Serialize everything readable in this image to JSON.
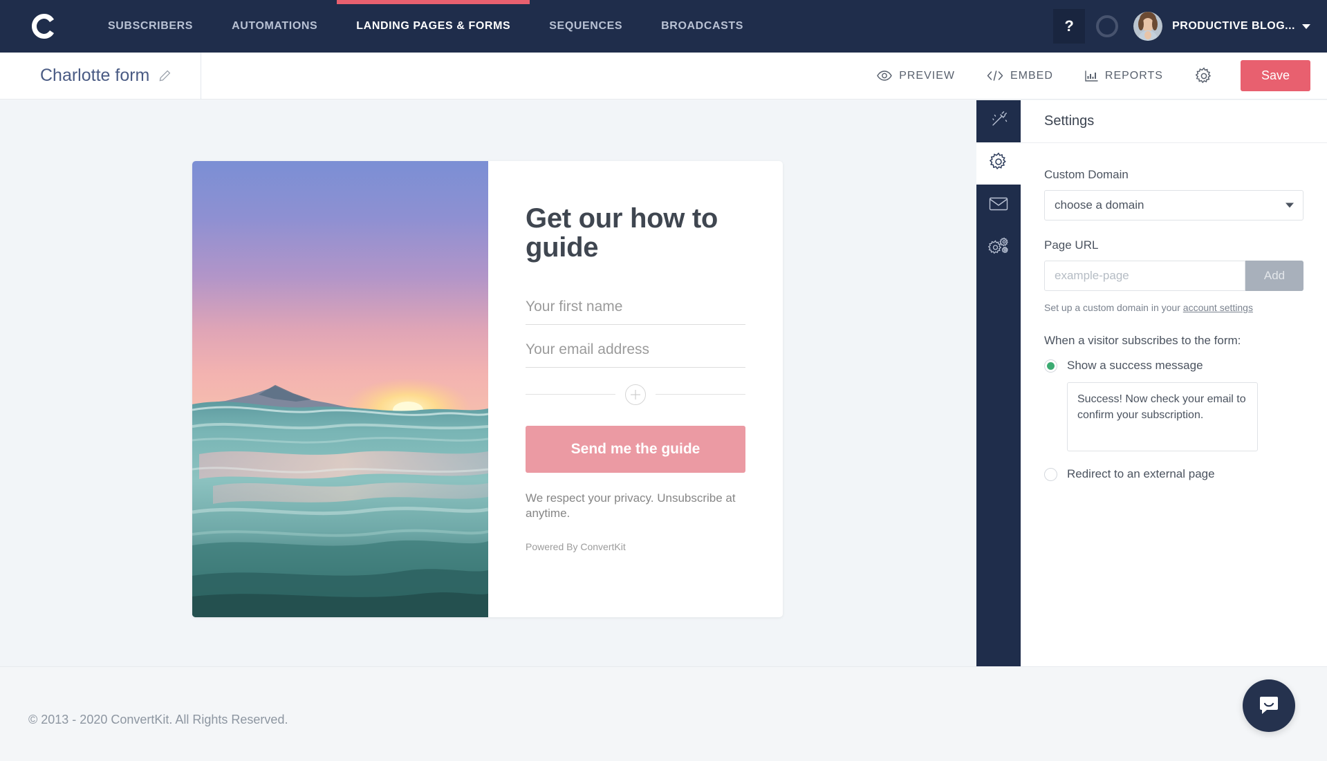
{
  "topnav": {
    "logo": "convertkit-logo",
    "items": [
      {
        "label": "SUBSCRIBERS",
        "active": false
      },
      {
        "label": "AUTOMATIONS",
        "active": false
      },
      {
        "label": "LANDING PAGES & FORMS",
        "active": true
      },
      {
        "label": "SEQUENCES",
        "active": false
      },
      {
        "label": "BROADCASTS",
        "active": false
      }
    ],
    "help_label": "?",
    "account_name": "PRODUCTIVE BLOG...",
    "active_indicator_color": "#e8606f",
    "background_color": "#1f2d4b"
  },
  "toolbar": {
    "form_title": "Charlotte form",
    "actions": [
      {
        "label": "PREVIEW",
        "icon": "eye-icon"
      },
      {
        "label": "EMBED",
        "icon": "code-icon"
      },
      {
        "label": "REPORTS",
        "icon": "bar-chart-icon"
      }
    ],
    "settings_icon": "gear-icon",
    "save_label": "Save",
    "save_color": "#e8606f"
  },
  "landing_page": {
    "image_alt": "ocean-sunset-photo",
    "heading": "Get our how to guide",
    "fields": [
      {
        "placeholder": "Your first name"
      },
      {
        "placeholder": "Your email address"
      }
    ],
    "add_field_icon": "plus-circle-icon",
    "cta_label": "Send me the guide",
    "cta_color": "#eb9aa3",
    "privacy_text": "We respect your privacy. Unsubscribe at anytime.",
    "powered_by": "Powered By ConvertKit"
  },
  "rail": {
    "items": [
      {
        "icon": "magic-wand-icon",
        "active": false
      },
      {
        "icon": "gear-icon",
        "active": true
      },
      {
        "icon": "envelope-icon",
        "active": false
      },
      {
        "icon": "advanced-settings-icon",
        "active": false
      }
    ]
  },
  "settings": {
    "title": "Settings",
    "custom_domain_label": "Custom Domain",
    "custom_domain_value": "choose a domain",
    "page_url_label": "Page URL",
    "page_url_value": "",
    "page_url_placeholder": "example-page",
    "add_label": "Add",
    "helper_prefix": "Set up a custom domain in your ",
    "helper_link": "account settings",
    "subscribe_label": "When a visitor subscribes to the form:",
    "options": [
      {
        "label": "Show a success message",
        "selected": true
      },
      {
        "label": "Redirect to an external page",
        "selected": false
      }
    ],
    "success_message": "Success! Now check your email to confirm your subscription.",
    "selected_color": "#3cab72"
  },
  "footer": {
    "copyright": "© 2013 - 2020 ConvertKit. All Rights Reserved.",
    "chat_icon": "intercom-chat-icon"
  }
}
